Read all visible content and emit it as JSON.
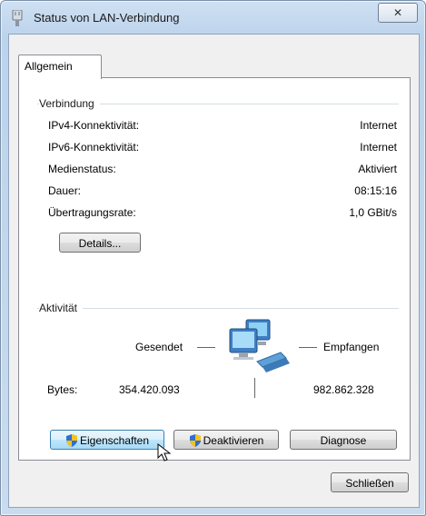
{
  "window": {
    "title": "Status von LAN-Verbindung",
    "close_glyph": "✕"
  },
  "tabs": [
    {
      "label": "Allgemein"
    }
  ],
  "connection": {
    "group_label": "Verbindung",
    "rows": [
      {
        "label": "IPv4-Konnektivität:",
        "value": "Internet"
      },
      {
        "label": "IPv6-Konnektivität:",
        "value": "Internet"
      },
      {
        "label": "Medienstatus:",
        "value": "Aktiviert"
      },
      {
        "label": "Dauer:",
        "value": "08:15:16"
      },
      {
        "label": "Übertragungsrate:",
        "value": "1,0 GBit/s"
      }
    ],
    "details_button": "Details..."
  },
  "activity": {
    "group_label": "Aktivität",
    "sent_label": "Gesendet",
    "received_label": "Empfangen",
    "bytes_label": "Bytes:",
    "bytes_sent": "354.420.093",
    "bytes_received": "982.862.328",
    "icon": "network-computers-icon"
  },
  "buttons": {
    "properties": "Eigenschaften",
    "disable": "Deaktivieren",
    "diagnose": "Diagnose",
    "close": "Schließen"
  },
  "colors": {
    "focus_border": "#3c7fb1",
    "window_frame": "#bcd3ec"
  }
}
